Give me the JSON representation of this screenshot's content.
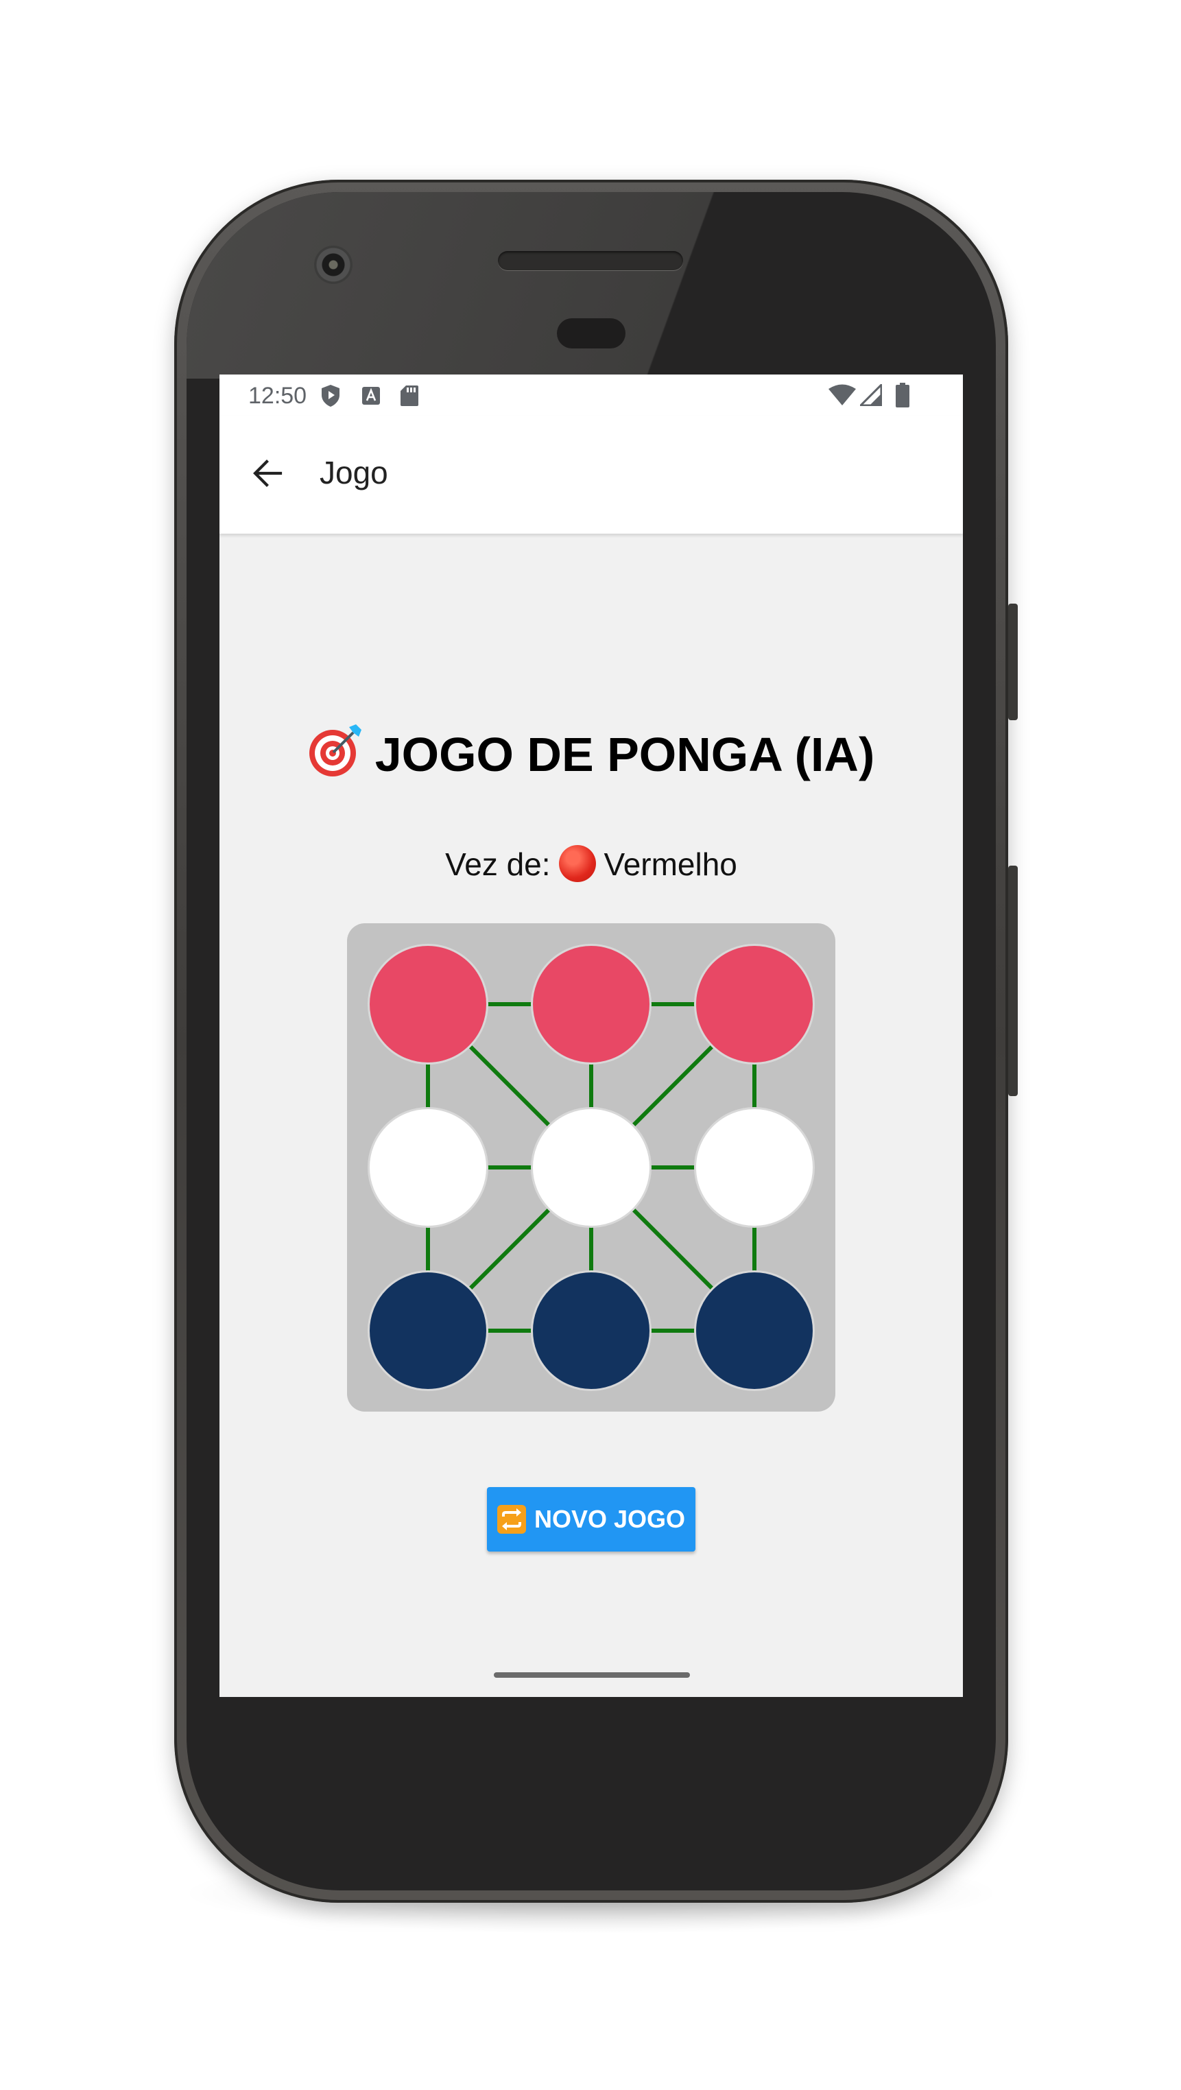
{
  "status_bar": {
    "time": "12:50",
    "icons_left": [
      "shield-play-icon",
      "a-letter-icon",
      "sd-card-icon"
    ],
    "icons_right": [
      "wifi-icon",
      "signal-icon",
      "battery-icon"
    ]
  },
  "app_bar": {
    "back_icon": "arrow-left-icon",
    "title": "Jogo"
  },
  "game": {
    "title_icon": "target-icon",
    "title": "JOGO DE PONGA (IA)",
    "turn_label": "Vez de:",
    "turn_icon": "red-circle-icon",
    "turn_player": "Vermelho",
    "board": {
      "rows": [
        [
          "red",
          "red",
          "red"
        ],
        [
          "empty",
          "empty",
          "empty"
        ],
        [
          "blue",
          "blue",
          "blue"
        ]
      ]
    },
    "new_game_icon": "repeat-icon",
    "new_game_label": "NOVO JOGO"
  },
  "colors": {
    "red_piece": "#e84865",
    "empty_piece": "#ffffff",
    "blue_piece": "#12335f",
    "board_lines": "#0f7a0f",
    "board_bg": "#c2c2c2",
    "button": "#2196f3"
  }
}
